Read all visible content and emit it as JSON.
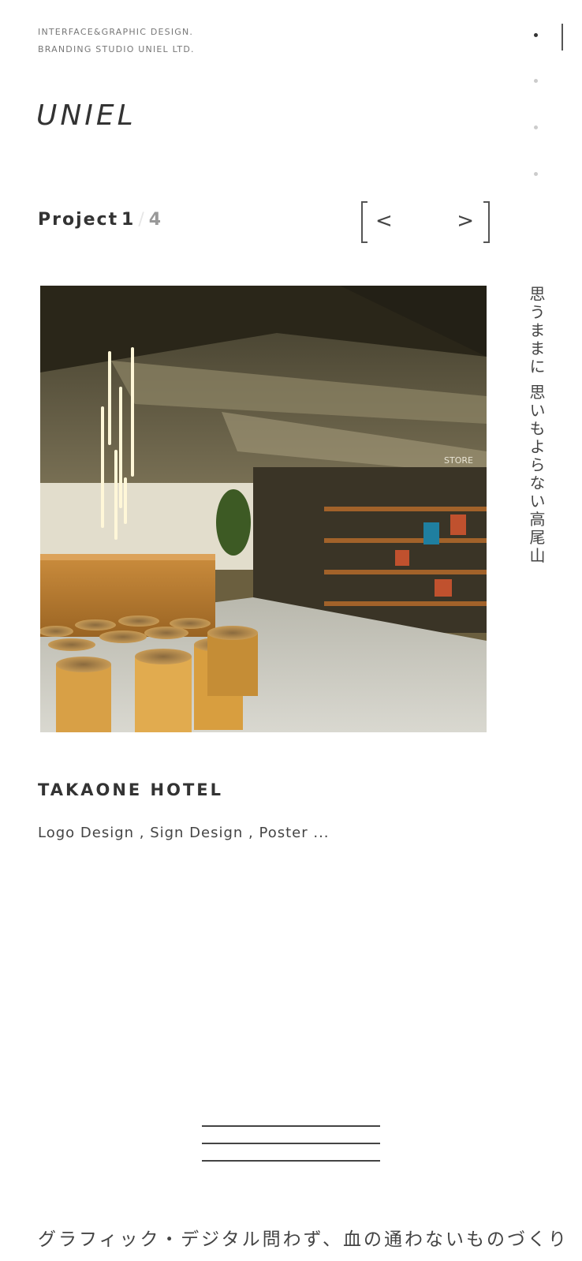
{
  "header": {
    "tagline_line1": "INTERFACE&GRAPHIC DESIGN.",
    "tagline_line2": "BRANDING STUDIO UNIEL LTD.",
    "logo": "UNIEL"
  },
  "nav_dots": {
    "count": 4,
    "active_index": 0
  },
  "project": {
    "label": "Project",
    "current": "1",
    "separator": "/",
    "total": "4",
    "prev_arrow": "<",
    "next_arrow": ">",
    "title": "TAKAONE HOTEL",
    "tags": "Logo Design  ,  Sign Design  ,  Poster ..."
  },
  "vertical_copy": "思うままに 思いもよらない高尾山",
  "footer_copy": "グラフィック・デジタル問わず、血の通わないものづくり",
  "image_sign_text": "STORE",
  "icons": {
    "prev": "chevron-left-icon",
    "next": "chevron-right-icon",
    "menu": "hamburger-menu-icon"
  },
  "colors": {
    "text": "#333333",
    "muted": "#999999",
    "dot_inactive": "#cccccc",
    "dot_active": "#333333"
  }
}
